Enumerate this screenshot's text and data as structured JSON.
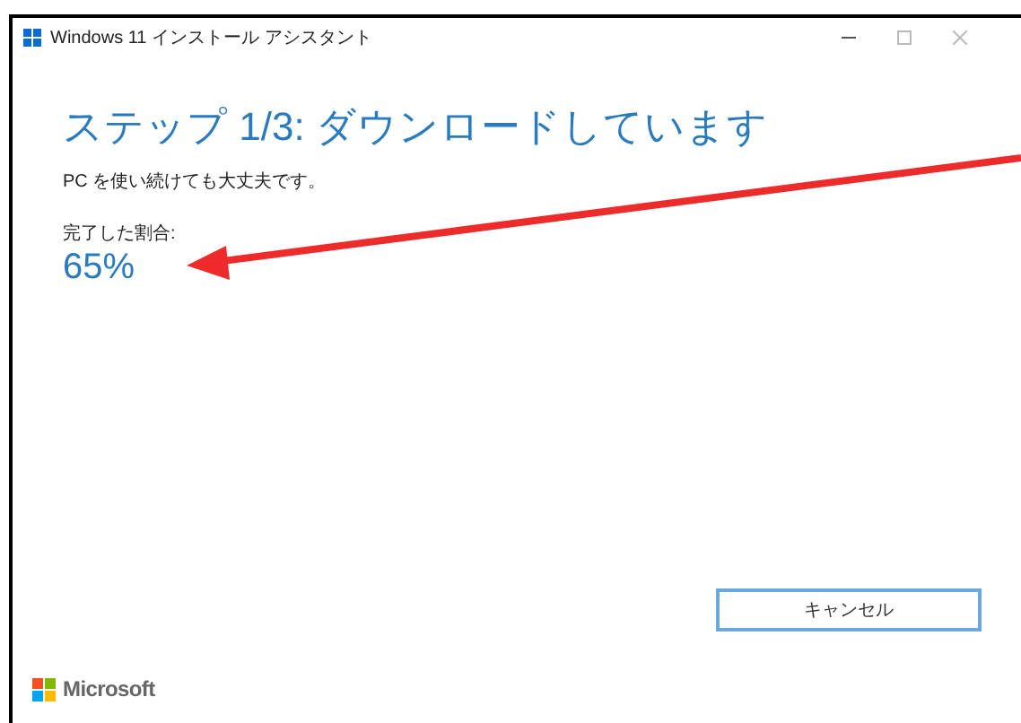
{
  "window": {
    "title": "Windows 11 インストール アシスタント"
  },
  "heading": "ステップ 1/3: ダウンロードしています",
  "subtitle": "PC を使い続けても大丈夫です。",
  "progress": {
    "label": "完了した割合:",
    "value": "65%"
  },
  "buttons": [
    "キャンセル"
  ],
  "footer": {
    "brand": "Microsoft"
  }
}
